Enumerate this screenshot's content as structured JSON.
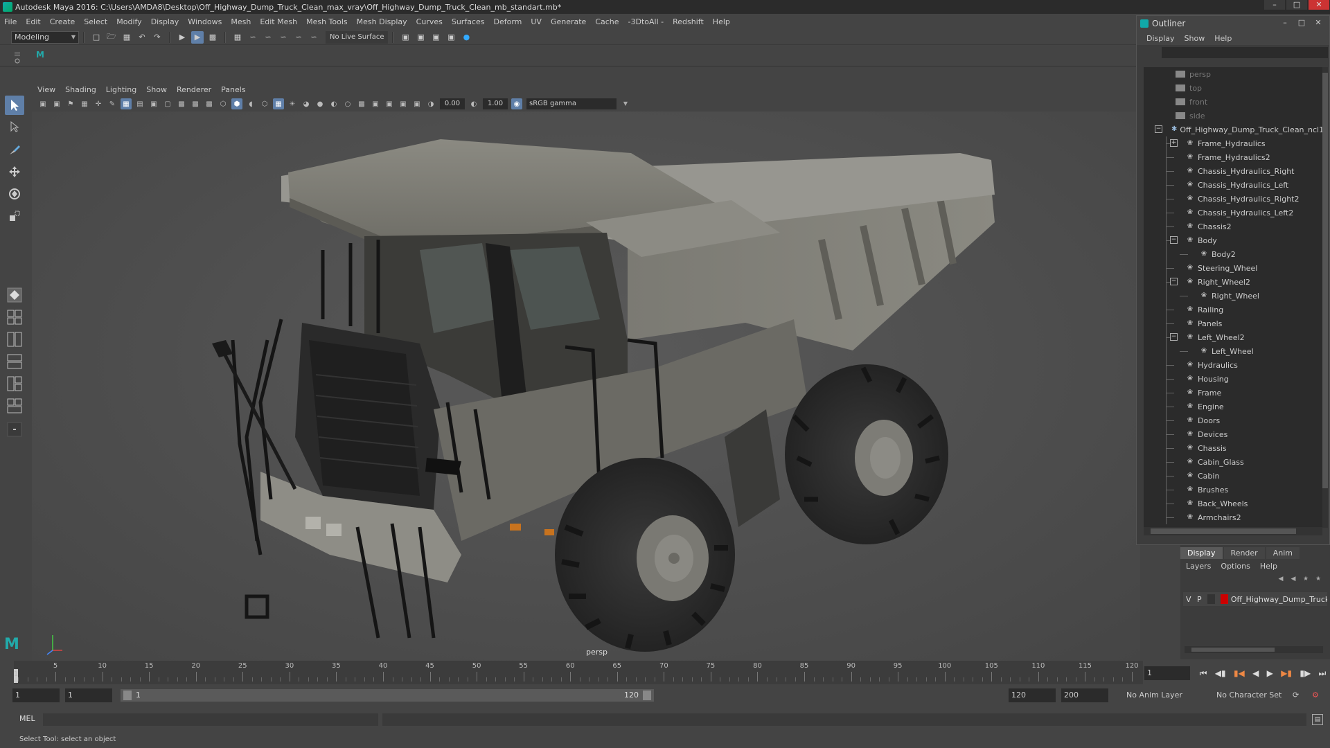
{
  "titlebar": {
    "title": "Autodesk Maya 2016: C:\\Users\\AMDA8\\Desktop\\Off_Highway_Dump_Truck_Clean_max_vray\\Off_Highway_Dump_Truck_Clean_mb_standart.mb*",
    "minimize": "–",
    "maximize": "□",
    "close": "✕"
  },
  "menubar": [
    "File",
    "Edit",
    "Create",
    "Select",
    "Modify",
    "Display",
    "Windows",
    "Mesh",
    "Edit Mesh",
    "Mesh Tools",
    "Mesh Display",
    "Curves",
    "Surfaces",
    "Deform",
    "UV",
    "Generate",
    "Cache",
    "-3DtoAll -",
    "Redshift",
    "Help"
  ],
  "statusline": {
    "mode": "Modeling",
    "live_surface": "No Live Surface"
  },
  "viewport": {
    "menu": [
      "View",
      "Shading",
      "Lighting",
      "Show",
      "Renderer",
      "Panels"
    ],
    "exposure": "0.00",
    "gamma": "1.00",
    "color_space": "sRGB gamma",
    "camera": "persp"
  },
  "outliner": {
    "title": "Outliner",
    "menu": [
      "Display",
      "Show",
      "Help"
    ],
    "cameras": [
      "persp",
      "top",
      "front",
      "side"
    ],
    "root": "Off_Highway_Dump_Truck_Clean_ncl1",
    "items": [
      {
        "label": "Frame_Hydraulics",
        "depth": 1,
        "expand": "+"
      },
      {
        "label": "Frame_Hydraulics2",
        "depth": 1,
        "expand": ""
      },
      {
        "label": "Chassis_Hydraulics_Right",
        "depth": 1,
        "expand": ""
      },
      {
        "label": "Chassis_Hydraulics_Left",
        "depth": 1,
        "expand": ""
      },
      {
        "label": "Chassis_Hydraulics_Right2",
        "depth": 1,
        "expand": ""
      },
      {
        "label": "Chassis_Hydraulics_Left2",
        "depth": 1,
        "expand": ""
      },
      {
        "label": "Chassis2",
        "depth": 1,
        "expand": ""
      },
      {
        "label": "Body",
        "depth": 1,
        "expand": "−"
      },
      {
        "label": "Body2",
        "depth": 2,
        "expand": ""
      },
      {
        "label": "Steering_Wheel",
        "depth": 1,
        "expand": ""
      },
      {
        "label": "Right_Wheel2",
        "depth": 1,
        "expand": "−"
      },
      {
        "label": "Right_Wheel",
        "depth": 2,
        "expand": ""
      },
      {
        "label": "Railing",
        "depth": 1,
        "expand": ""
      },
      {
        "label": "Panels",
        "depth": 1,
        "expand": ""
      },
      {
        "label": "Left_Wheel2",
        "depth": 1,
        "expand": "−"
      },
      {
        "label": "Left_Wheel",
        "depth": 2,
        "expand": ""
      },
      {
        "label": "Hydraulics",
        "depth": 1,
        "expand": ""
      },
      {
        "label": "Housing",
        "depth": 1,
        "expand": ""
      },
      {
        "label": "Frame",
        "depth": 1,
        "expand": ""
      },
      {
        "label": "Engine",
        "depth": 1,
        "expand": ""
      },
      {
        "label": "Doors",
        "depth": 1,
        "expand": ""
      },
      {
        "label": "Devices",
        "depth": 1,
        "expand": ""
      },
      {
        "label": "Chassis",
        "depth": 1,
        "expand": ""
      },
      {
        "label": "Cabin_Glass",
        "depth": 1,
        "expand": ""
      },
      {
        "label": "Cabin",
        "depth": 1,
        "expand": ""
      },
      {
        "label": "Brushes",
        "depth": 1,
        "expand": ""
      },
      {
        "label": "Back_Wheels",
        "depth": 1,
        "expand": ""
      },
      {
        "label": "Armchairs2",
        "depth": 1,
        "expand": ""
      }
    ]
  },
  "layers": {
    "tabs": [
      "Display",
      "Render",
      "Anim"
    ],
    "menu": [
      "Layers",
      "Options",
      "Help"
    ],
    "row": {
      "v": "V",
      "p": "P",
      "name": "Off_Highway_Dump_Truck_Clean",
      "color": "#c00000"
    }
  },
  "timeline": {
    "ticks": [
      1,
      5,
      10,
      15,
      20,
      25,
      30,
      35,
      40,
      45,
      50,
      55,
      60,
      65,
      70,
      75,
      80,
      85,
      90,
      95,
      100,
      105,
      110,
      115,
      120
    ],
    "labels": [
      "5",
      "10",
      "15",
      "20",
      "25",
      "30",
      "35",
      "40",
      "45",
      "50",
      "55",
      "60",
      "65",
      "70",
      "75",
      "80",
      "85",
      "90",
      "95",
      "100",
      "105",
      "110",
      "115",
      "120"
    ],
    "start_label": "1",
    "current_frame": "1"
  },
  "range": {
    "start": "1",
    "playback_start": "1",
    "bar_start": "1",
    "bar_end": "120",
    "playback_end": "120",
    "end": "200",
    "anim_layer": "No Anim Layer",
    "character_set": "No Character Set"
  },
  "cmdline": {
    "label": "MEL",
    "help": "Select Tool: select an object"
  }
}
